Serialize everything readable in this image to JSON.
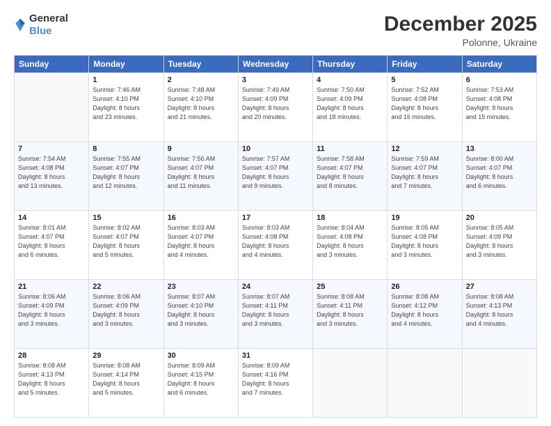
{
  "logo": {
    "general": "General",
    "blue": "Blue"
  },
  "header": {
    "title": "December 2025",
    "subtitle": "Polonne, Ukraine"
  },
  "weekdays": [
    "Sunday",
    "Monday",
    "Tuesday",
    "Wednesday",
    "Thursday",
    "Friday",
    "Saturday"
  ],
  "weeks": [
    [
      {
        "day": "",
        "info": ""
      },
      {
        "day": "1",
        "info": "Sunrise: 7:46 AM\nSunset: 4:10 PM\nDaylight: 8 hours\nand 23 minutes."
      },
      {
        "day": "2",
        "info": "Sunrise: 7:48 AM\nSunset: 4:10 PM\nDaylight: 8 hours\nand 21 minutes."
      },
      {
        "day": "3",
        "info": "Sunrise: 7:49 AM\nSunset: 4:09 PM\nDaylight: 8 hours\nand 20 minutes."
      },
      {
        "day": "4",
        "info": "Sunrise: 7:50 AM\nSunset: 4:09 PM\nDaylight: 8 hours\nand 18 minutes."
      },
      {
        "day": "5",
        "info": "Sunrise: 7:52 AM\nSunset: 4:08 PM\nDaylight: 8 hours\nand 16 minutes."
      },
      {
        "day": "6",
        "info": "Sunrise: 7:53 AM\nSunset: 4:08 PM\nDaylight: 8 hours\nand 15 minutes."
      }
    ],
    [
      {
        "day": "7",
        "info": "Sunrise: 7:54 AM\nSunset: 4:08 PM\nDaylight: 8 hours\nand 13 minutes."
      },
      {
        "day": "8",
        "info": "Sunrise: 7:55 AM\nSunset: 4:07 PM\nDaylight: 8 hours\nand 12 minutes."
      },
      {
        "day": "9",
        "info": "Sunrise: 7:56 AM\nSunset: 4:07 PM\nDaylight: 8 hours\nand 11 minutes."
      },
      {
        "day": "10",
        "info": "Sunrise: 7:57 AM\nSunset: 4:07 PM\nDaylight: 8 hours\nand 9 minutes."
      },
      {
        "day": "11",
        "info": "Sunrise: 7:58 AM\nSunset: 4:07 PM\nDaylight: 8 hours\nand 8 minutes."
      },
      {
        "day": "12",
        "info": "Sunrise: 7:59 AM\nSunset: 4:07 PM\nDaylight: 8 hours\nand 7 minutes."
      },
      {
        "day": "13",
        "info": "Sunrise: 8:00 AM\nSunset: 4:07 PM\nDaylight: 8 hours\nand 6 minutes."
      }
    ],
    [
      {
        "day": "14",
        "info": "Sunrise: 8:01 AM\nSunset: 4:07 PM\nDaylight: 8 hours\nand 6 minutes."
      },
      {
        "day": "15",
        "info": "Sunrise: 8:02 AM\nSunset: 4:07 PM\nDaylight: 8 hours\nand 5 minutes."
      },
      {
        "day": "16",
        "info": "Sunrise: 8:03 AM\nSunset: 4:07 PM\nDaylight: 8 hours\nand 4 minutes."
      },
      {
        "day": "17",
        "info": "Sunrise: 8:03 AM\nSunset: 4:08 PM\nDaylight: 8 hours\nand 4 minutes."
      },
      {
        "day": "18",
        "info": "Sunrise: 8:04 AM\nSunset: 4:08 PM\nDaylight: 8 hours\nand 3 minutes."
      },
      {
        "day": "19",
        "info": "Sunrise: 8:05 AM\nSunset: 4:08 PM\nDaylight: 8 hours\nand 3 minutes."
      },
      {
        "day": "20",
        "info": "Sunrise: 8:05 AM\nSunset: 4:09 PM\nDaylight: 8 hours\nand 3 minutes."
      }
    ],
    [
      {
        "day": "21",
        "info": "Sunrise: 8:06 AM\nSunset: 4:09 PM\nDaylight: 8 hours\nand 3 minutes."
      },
      {
        "day": "22",
        "info": "Sunrise: 8:06 AM\nSunset: 4:09 PM\nDaylight: 8 hours\nand 3 minutes."
      },
      {
        "day": "23",
        "info": "Sunrise: 8:07 AM\nSunset: 4:10 PM\nDaylight: 8 hours\nand 3 minutes."
      },
      {
        "day": "24",
        "info": "Sunrise: 8:07 AM\nSunset: 4:11 PM\nDaylight: 8 hours\nand 3 minutes."
      },
      {
        "day": "25",
        "info": "Sunrise: 8:08 AM\nSunset: 4:11 PM\nDaylight: 8 hours\nand 3 minutes."
      },
      {
        "day": "26",
        "info": "Sunrise: 8:08 AM\nSunset: 4:12 PM\nDaylight: 8 hours\nand 4 minutes."
      },
      {
        "day": "27",
        "info": "Sunrise: 8:08 AM\nSunset: 4:13 PM\nDaylight: 8 hours\nand 4 minutes."
      }
    ],
    [
      {
        "day": "28",
        "info": "Sunrise: 8:08 AM\nSunset: 4:13 PM\nDaylight: 8 hours\nand 5 minutes."
      },
      {
        "day": "29",
        "info": "Sunrise: 8:08 AM\nSunset: 4:14 PM\nDaylight: 8 hours\nand 5 minutes."
      },
      {
        "day": "30",
        "info": "Sunrise: 8:09 AM\nSunset: 4:15 PM\nDaylight: 8 hours\nand 6 minutes."
      },
      {
        "day": "31",
        "info": "Sunrise: 8:09 AM\nSunset: 4:16 PM\nDaylight: 8 hours\nand 7 minutes."
      },
      {
        "day": "",
        "info": ""
      },
      {
        "day": "",
        "info": ""
      },
      {
        "day": "",
        "info": ""
      }
    ]
  ]
}
